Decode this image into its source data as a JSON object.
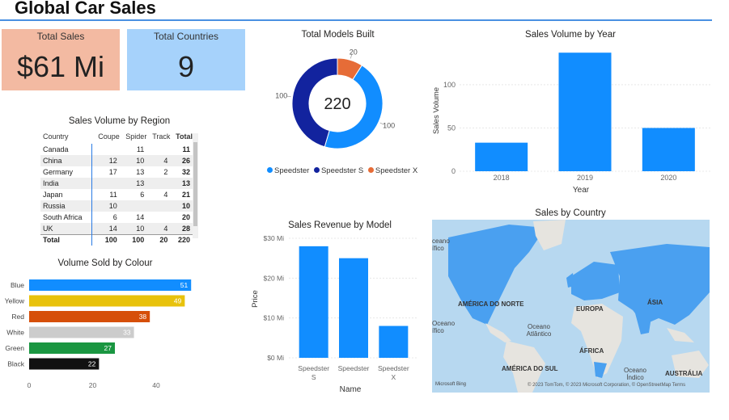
{
  "dashboard": {
    "title": "Global Car Sales"
  },
  "cards": {
    "total_sales": {
      "label": "Total Sales",
      "value": "$61 Mi"
    },
    "total_countries": {
      "label": "Total Countries",
      "value": "9"
    }
  },
  "chart_data": [
    {
      "id": "models",
      "type": "pie",
      "title": "Total Models Built",
      "center_label": "220",
      "categories": [
        "Speedster",
        "Speedster S",
        "Speedster X"
      ],
      "values": [
        100,
        100,
        20
      ],
      "data_labels": [
        "100",
        "100",
        "20"
      ],
      "colors": [
        "#118dff",
        "#12239e",
        "#e66c37"
      ],
      "legend": "bottom"
    },
    {
      "id": "year",
      "type": "bar",
      "title": "Sales Volume by Year",
      "categories": [
        "2018",
        "2019",
        "2020"
      ],
      "values": [
        33,
        137,
        50
      ],
      "xlabel": "Year",
      "ylabel": "Sales Volume",
      "ylim": [
        0,
        140
      ],
      "yticks": [
        0,
        50,
        100
      ],
      "grid": true,
      "color": "#118dff"
    },
    {
      "id": "region",
      "type": "table",
      "title": "Sales Volume by Region",
      "columns": [
        "Country",
        "Coupe",
        "Spider",
        "Track",
        "Total"
      ],
      "rows": [
        [
          "Canada",
          "",
          "11",
          "",
          "11"
        ],
        [
          "China",
          "12",
          "10",
          "4",
          "26"
        ],
        [
          "Germany",
          "17",
          "13",
          "2",
          "32"
        ],
        [
          "India",
          "",
          "13",
          "",
          "13"
        ],
        [
          "Japan",
          "11",
          "6",
          "4",
          "21"
        ],
        [
          "Russia",
          "10",
          "",
          "",
          "10"
        ],
        [
          "South Africa",
          "6",
          "14",
          "",
          "20"
        ],
        [
          "UK",
          "14",
          "10",
          "4",
          "28"
        ]
      ],
      "total_row": [
        "Total",
        "100",
        "100",
        "20",
        "220"
      ]
    },
    {
      "id": "revenue",
      "type": "bar",
      "title": "Sales Revenue by Model",
      "categories": [
        "Speedster S",
        "Speedster",
        "Speedster X"
      ],
      "category_lines": [
        [
          "Speedster",
          "S"
        ],
        [
          "Speedster"
        ],
        [
          "Speedster",
          "X"
        ]
      ],
      "values": [
        28,
        25,
        8
      ],
      "value_unit": "$ Mi",
      "xlabel": "Name",
      "ylabel": "Price",
      "ylim": [
        0,
        30
      ],
      "yticks": [
        0,
        10,
        20,
        30
      ],
      "ytick_labels": [
        "$0 Mi",
        "$10 Mi",
        "$20 Mi",
        "$30 Mi"
      ],
      "grid": true,
      "color": "#118dff"
    },
    {
      "id": "colour",
      "type": "bar",
      "orientation": "horizontal",
      "title": "Volume Sold by Colour",
      "categories": [
        "Blue",
        "Yellow",
        "Red",
        "White",
        "Green",
        "Black"
      ],
      "values": [
        51,
        49,
        38,
        33,
        27,
        22
      ],
      "colors": [
        "#118dff",
        "#e8c20c",
        "#d64f09",
        "#cccccc",
        "#1a9641",
        "#111111"
      ],
      "xlim": [
        0,
        54
      ],
      "xticks": [
        0,
        20,
        40
      ]
    }
  ],
  "map": {
    "title": "Sales by Country",
    "labels": {
      "north_america": "AMÉRICA DO NORTE",
      "europe": "EUROPA",
      "asia": "ÁSIA",
      "africa": "ÁFRICA",
      "south_america": "AMÉRICA DO SUL",
      "australia": "AUSTRÁLIA",
      "ocean_atlantic": "Oceano Atlântico",
      "ocean_pacific_a": "ceano ",
      "ocean_pacific_b": "ífico",
      "ocean_pacific_c": "Oceano",
      "ocean_pacific_d": "ífico",
      "ocean_indian": "Oceano Índico"
    },
    "attribution": "© 2023 TomTom, © 2023 Microsoft Corporation, © OpenStreetMap Terms",
    "provider": "Microsoft Bing",
    "colors": {
      "water": "#b7d8f0",
      "land": "#e6e4df",
      "highlight": "#4aa0f0"
    }
  }
}
